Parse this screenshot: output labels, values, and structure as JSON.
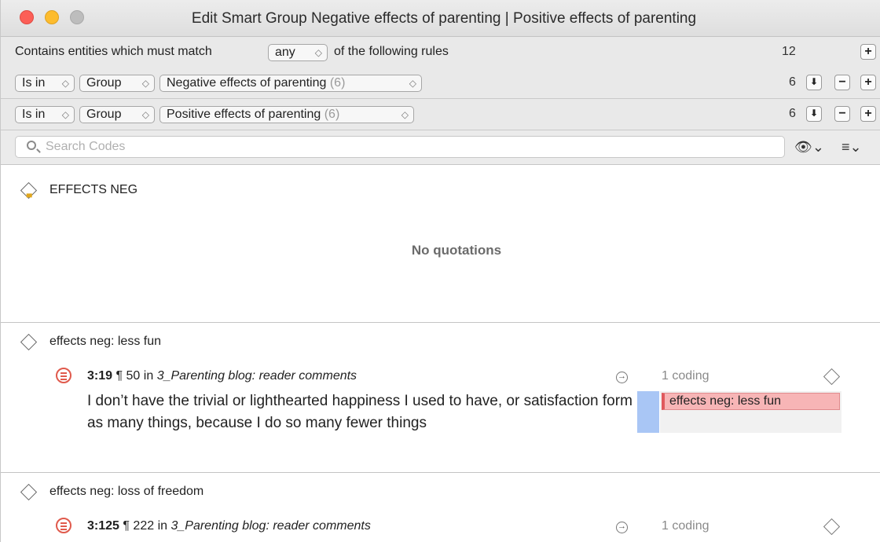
{
  "window": {
    "title": "Edit Smart Group Negative effects of parenting | Positive effects of parenting"
  },
  "rules_header": {
    "prefix": "Contains entities which must match",
    "match_value": "any",
    "suffix": "of the following rules",
    "total_count": "12",
    "add_label": "+"
  },
  "rules": [
    {
      "operator": "Is in",
      "type": "Group",
      "value": "Negative effects of parenting",
      "value_count": "(6)",
      "count": "6"
    },
    {
      "operator": "Is in",
      "type": "Group",
      "value": "Positive effects of parenting",
      "value_count": "(6)",
      "count": "6"
    }
  ],
  "buttons": {
    "minus": "−",
    "plus": "+"
  },
  "search": {
    "placeholder": "Search Codes"
  },
  "codes": [
    {
      "name": "EFFECTS NEG",
      "empty_text": "No quotations"
    },
    {
      "name": "effects neg: less fun",
      "quotation": {
        "id": "3:19",
        "para": "¶ 50",
        "in": "in",
        "document": "3_Parenting blog: reader comments",
        "coding_count": "1 coding",
        "text": "I don’t have the trivial or lighthearted happiness I used to have, or satisfaction form as many things, because I do so many fewer things",
        "codes": [
          "effects neg: less fun"
        ]
      }
    },
    {
      "name": "effects neg: loss of freedom",
      "quotation": {
        "id": "3:125",
        "para": "¶ 222",
        "in": "in",
        "document": "3_Parenting blog: reader comments",
        "coding_count": "1 coding"
      }
    }
  ],
  "colors": {
    "close": "#fc5f57",
    "minimize": "#fdbc2e",
    "quotation_icon": "#e05a4c",
    "code_chip": "#f7b5b6",
    "highlight_bar": "#a9c6f5"
  },
  "icons": {
    "eye": "eye-icon",
    "list": "list-icon",
    "search": "search-icon",
    "goto": "goto-arrow-icon"
  }
}
